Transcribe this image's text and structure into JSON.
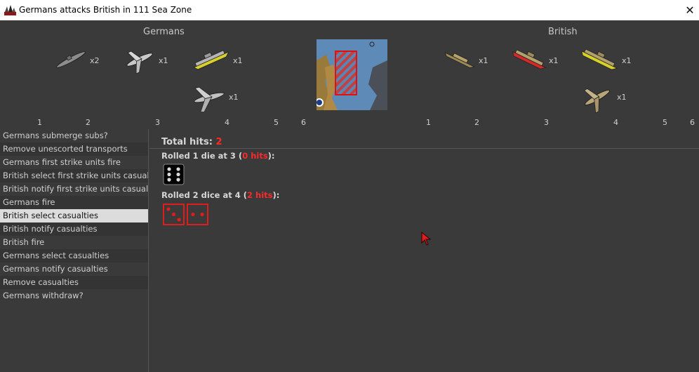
{
  "window": {
    "title": "Germans attacks British in 111 Sea Zone",
    "close_glyph": "✕"
  },
  "attacker": {
    "name": "Germans",
    "units": [
      {
        "type": "submarine",
        "count": "x2"
      },
      {
        "type": "fighter",
        "count": "x1"
      },
      {
        "type": "battleship",
        "count": "x1"
      },
      {
        "type": "bomber",
        "count": "x1"
      }
    ],
    "columns": [
      "1",
      "2",
      "3",
      "4",
      "5",
      "6"
    ]
  },
  "defender": {
    "name": "British",
    "units": [
      {
        "type": "destroyer",
        "count": "x1"
      },
      {
        "type": "battleship-damaged",
        "count": "x1"
      },
      {
        "type": "battleship",
        "count": "x1"
      },
      {
        "type": "fighter",
        "count": "x1"
      }
    ],
    "columns": [
      "1",
      "2",
      "3",
      "4",
      "5",
      "6"
    ]
  },
  "steps": [
    {
      "label": "Germans submerge subs?",
      "selected": false
    },
    {
      "label": "Remove unescorted transports",
      "selected": false
    },
    {
      "label": "Germans first strike units fire",
      "selected": false
    },
    {
      "label": "British select first strike units casualties",
      "selected": false
    },
    {
      "label": "British notify first strike units casualties",
      "selected": false
    },
    {
      "label": "Germans fire",
      "selected": false
    },
    {
      "label": "British select casualties",
      "selected": true
    },
    {
      "label": "British notify casualties",
      "selected": false
    },
    {
      "label": "British fire",
      "selected": false
    },
    {
      "label": "Germans select casualties",
      "selected": false
    },
    {
      "label": "Germans notify casualties",
      "selected": false
    },
    {
      "label": "Remove casualties",
      "selected": false
    },
    {
      "label": "Germans withdraw?",
      "selected": false
    }
  ],
  "results": {
    "total_label": "Total hits:",
    "total_value": "2",
    "rolls": [
      {
        "prefix": "Rolled 1 die at 3 (",
        "hits": "0 hits",
        "suffix": "):",
        "dice": [
          6
        ],
        "hit": false
      },
      {
        "prefix": "Rolled 2 dice at 4 (",
        "hits": "2 hits",
        "suffix": "):",
        "dice": [
          3,
          2
        ],
        "hit": true
      }
    ]
  },
  "colors": {
    "hit": "#ff2a2a",
    "miss_die": "#000000",
    "panel": "#3a3a3a",
    "selected_row": "#dcdcdc"
  }
}
